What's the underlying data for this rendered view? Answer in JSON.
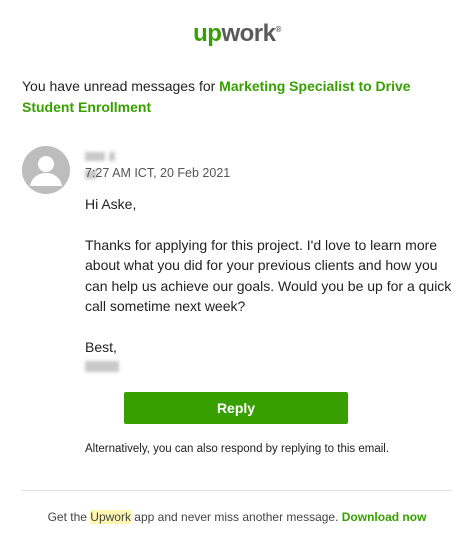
{
  "logo": {
    "up": "up",
    "work": "work",
    "tm": "®"
  },
  "intro": {
    "prefix": "You have unread messages for ",
    "job_title": "Marketing Specialist to Drive Student Enrollment"
  },
  "message": {
    "sender_name": "",
    "timestamp": "7:27 AM ICT, 20 Feb 2021",
    "greeting": "Hi Aske,",
    "body": "Thanks for applying for this project. I'd love to learn more about what you did for your previous clients and how you can help us achieve our goals. Would you be up for a quick call sometime next week?",
    "closing": "Best,"
  },
  "actions": {
    "reply_label": "Reply",
    "alternative_text": "Alternatively, you can also respond by replying to this email."
  },
  "footer": {
    "prefix": "Get the ",
    "brand": "Upwork",
    "middle": " app and never miss another message. ",
    "download_label": "Download now"
  },
  "colors": {
    "brand_green": "#37a000",
    "avatar_gray": "#bdbdbd"
  },
  "icons": {
    "avatar": "user-avatar-icon"
  }
}
